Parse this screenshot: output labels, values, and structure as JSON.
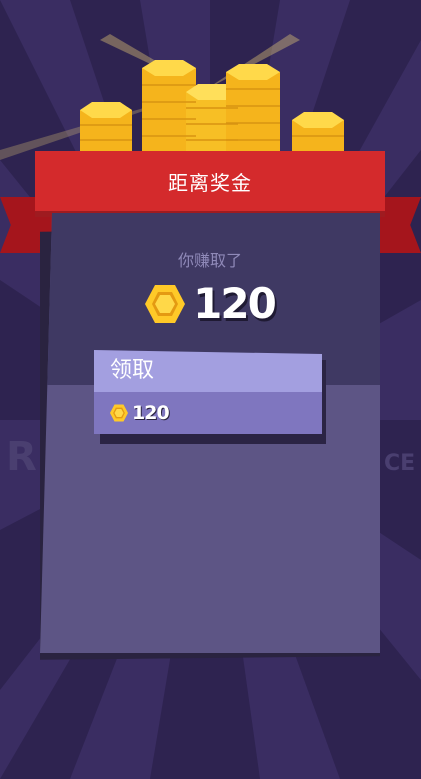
{
  "reward_screen": {
    "banner_title": "距离奖金",
    "earned_label": "你赚取了",
    "earned_amount": "120",
    "claim_button": {
      "label": "领取",
      "coin_amount": "120"
    }
  },
  "icons": {
    "coin": "coin-icon",
    "coin_stacks": "coin-stack-icon"
  },
  "colors": {
    "ribbon_red": "#d42a2c",
    "card_purple": "#5d5585",
    "card_dark": "#3f3963",
    "button_light": "#a39fe0",
    "button_dark": "#7f76bf",
    "coin_gold": "#ffc928"
  }
}
